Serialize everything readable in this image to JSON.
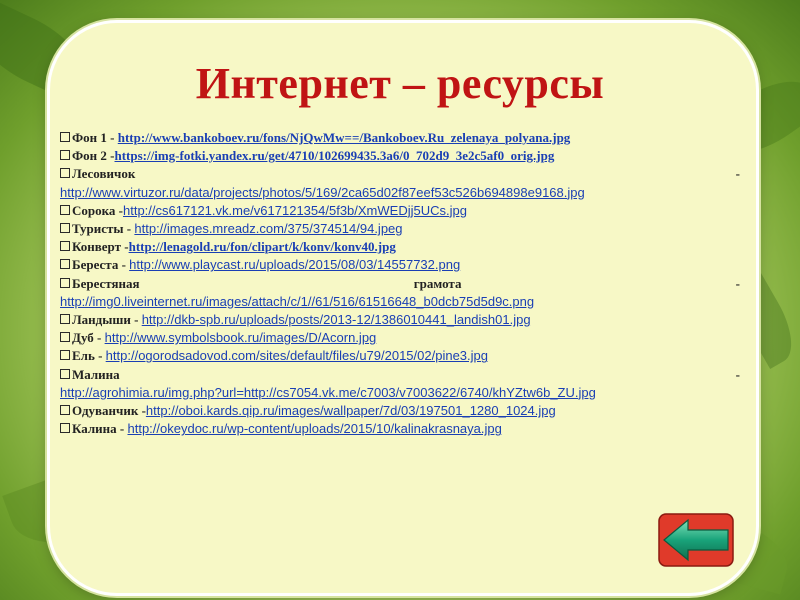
{
  "slide": {
    "title": "Интернет – ресурсы"
  },
  "colors": {
    "title": "#c01414",
    "link": "#1a3fb4",
    "panel": "#f7f8c6",
    "arrow": "#19a37a"
  },
  "resources": [
    {
      "label": "Фон 1 - ",
      "url": "http://www.bankoboev.ru/fons/NjQwMw==/Bankoboev.Ru_zelenaya_polyana.jpg"
    },
    {
      "label": "Фон 2 -",
      "url": "https://img-fotki.yandex.ru/get/4710/102699435.3a6/0_702d9_3e2c5af0_orig.jpg"
    },
    {
      "label": "Лесовичок",
      "dash": "-",
      "url": "http://www.virtuzor.ru/data/projects/photos/5/169/2ca65d02f87eef53c526b694898e9168.jpg"
    },
    {
      "label": "Сорока -",
      "url": "http://cs617121.vk.me/v617121354/5f3b/XmWEDjj5UCs.jpg"
    },
    {
      "label": "Туристы - ",
      "url": "http://images.mreadz.com/375/374514/94.jpeg"
    },
    {
      "label": "Конверт -",
      "url": "http://lenagold.ru/fon/clipart/k/konv/konv40.jpg"
    },
    {
      "label": "Береста - ",
      "url": "http://www.playcast.ru/uploads/2015/08/03/14557732.png"
    },
    {
      "label": "Берестяная",
      "middle": "грамота",
      "dash": "-",
      "url": "http://img0.liveinternet.ru/images/attach/c/1//61/516/61516648_b0dcb75d5d9c.png"
    },
    {
      "label": "Ландыши - ",
      "url": "http://dkb-spb.ru/uploads/posts/2013-12/1386010441_landish01.jpg"
    },
    {
      "label": "Дуб - ",
      "url": "http://www.symbolsbook.ru/images/D/Acorn.jpg"
    },
    {
      "label": "Ель - ",
      "url": "http://ogorodsadovod.com/sites/default/files/u79/2015/02/pine3.jpg"
    },
    {
      "label": "Малина",
      "dash": "-",
      "url": "http://agrohimia.ru/img.php?url=http://cs7054.vk.me/c7003/v7003622/6740/khYZtw6b_ZU.jpg"
    },
    {
      "label": "Одуванчик -",
      "url": "http://oboi.kards.qip.ru/images/wallpaper/7d/03/197501_1280_1024.jpg"
    },
    {
      "label": "Калина - ",
      "url": "http://okeydoc.ru/wp-content/uploads/2015/10/kalinakrasnaya.jpg"
    }
  ],
  "nav": {
    "back_icon": "arrow-left-icon"
  }
}
